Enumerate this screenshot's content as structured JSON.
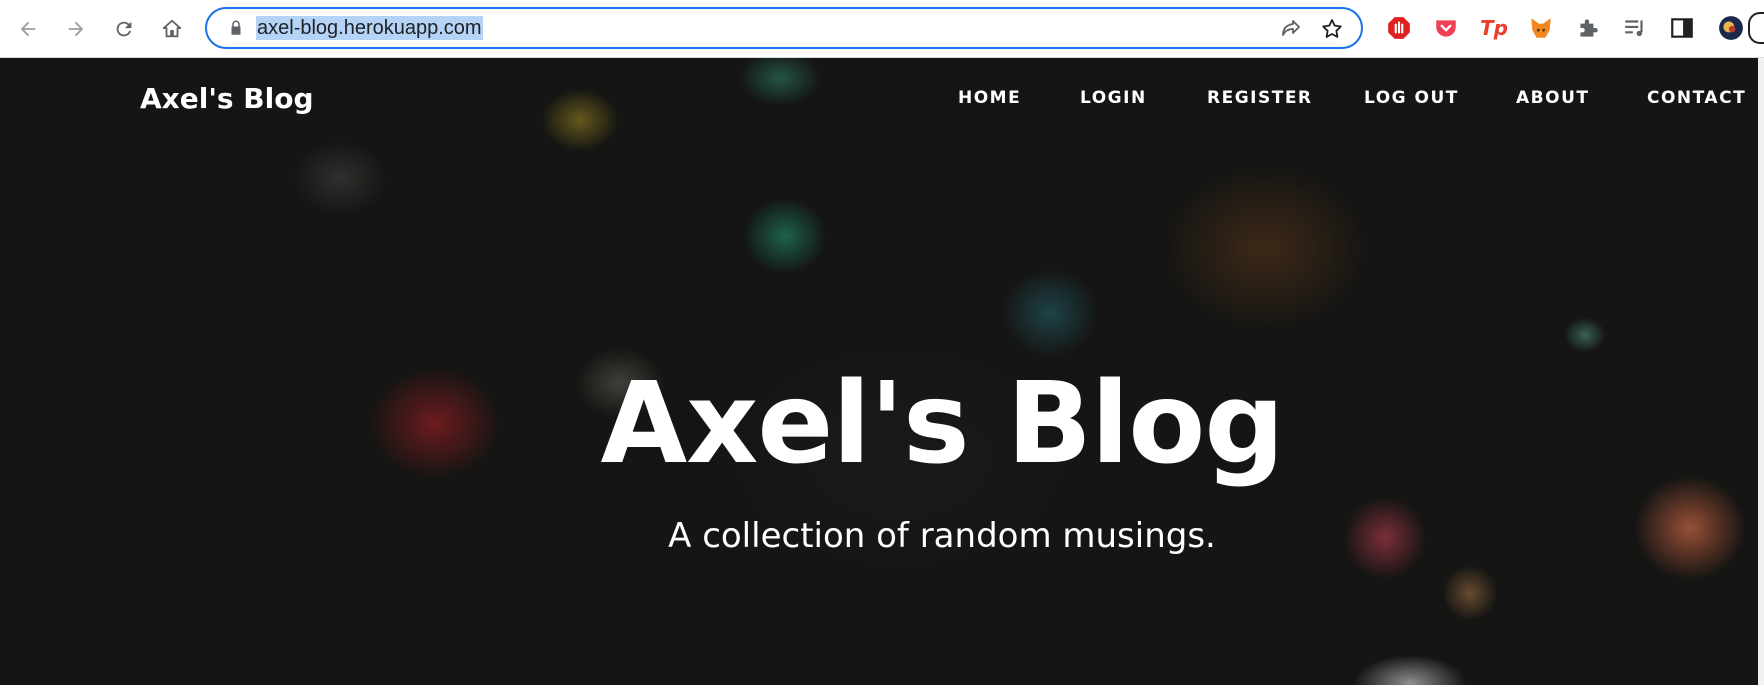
{
  "browser": {
    "url": "axel-blog.herokuapp.com",
    "icons": {
      "back": "back-arrow-icon",
      "forward": "forward-arrow-icon",
      "reload": "reload-icon",
      "home": "home-icon",
      "lock": "lock-icon",
      "share": "share-icon",
      "bookmark": "star-icon"
    },
    "extensions": [
      "stop-hand-icon",
      "pocket-icon",
      "tp-icon",
      "fox-icon",
      "puzzle-icon",
      "media-icon",
      "sidepanel-icon",
      "profile-avatar-icon"
    ],
    "extension_labels": {
      "tp": "Tp"
    },
    "accent_color": "#1a73e8"
  },
  "site": {
    "brand": "Axel's Blog",
    "nav": [
      "HOME",
      "LOGIN",
      "REGISTER",
      "LOG OUT",
      "ABOUT",
      "CONTACT"
    ],
    "hero": {
      "title": "Axel's Blog",
      "subtitle": "A collection of random musings."
    }
  }
}
